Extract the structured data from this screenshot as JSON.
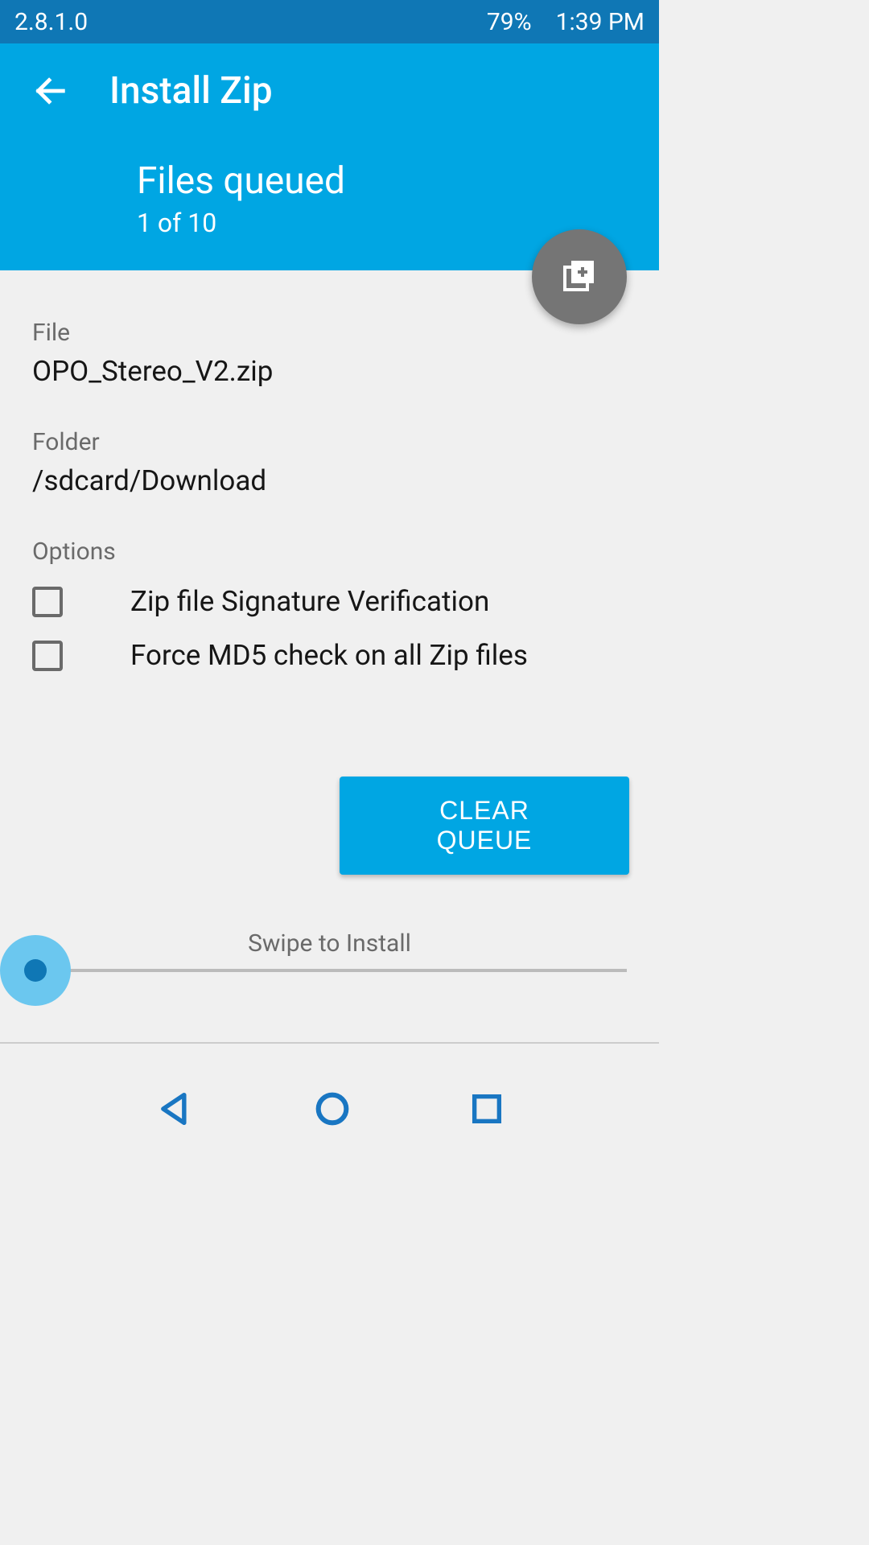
{
  "status": {
    "version": "2.8.1.0",
    "battery": "79%",
    "time": "1:39 PM"
  },
  "header": {
    "title": "Install Zip",
    "queue_title": "Files queued",
    "queue_count": "1 of 10"
  },
  "file": {
    "label": "File",
    "value": "OPO_Stereo_V2.zip"
  },
  "folder": {
    "label": "Folder",
    "value": "/sdcard/Download"
  },
  "options": {
    "heading": "Options",
    "items": [
      {
        "label": "Zip file Signature Verification",
        "checked": false
      },
      {
        "label": "Force MD5 check on all Zip files",
        "checked": false
      }
    ]
  },
  "buttons": {
    "clear_queue": "CLEAR QUEUE"
  },
  "swipe": {
    "label": "Swipe to Install"
  }
}
